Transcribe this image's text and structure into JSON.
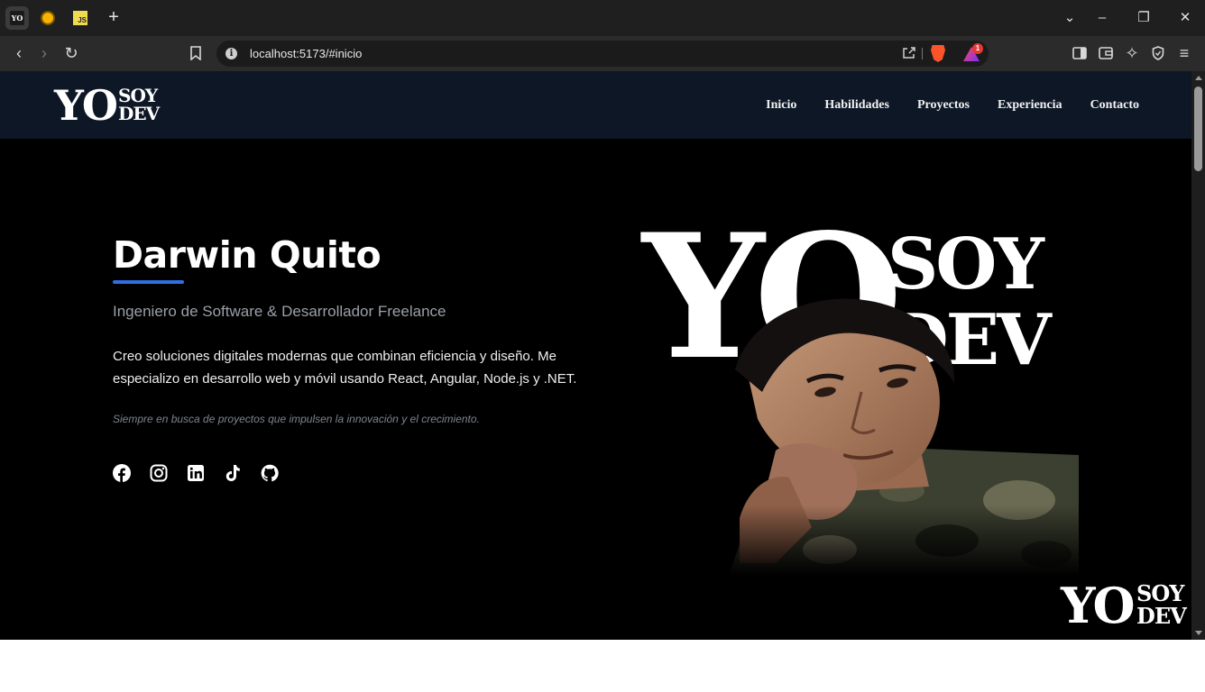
{
  "browser": {
    "url": "localhost:5173/#inicio",
    "tabs": [
      {
        "icon": "yosoydev-favicon"
      },
      {
        "icon": "bot-favicon"
      },
      {
        "icon": "js-favicon",
        "label": "JS"
      }
    ],
    "new_tab_label": "+",
    "notification_count": "1"
  },
  "site": {
    "logo": {
      "yo": "YO",
      "soy": "SOY",
      "dev": "DEV"
    },
    "nav": [
      "Inicio",
      "Habilidades",
      "Proyectos",
      "Experiencia",
      "Contacto"
    ],
    "hero": {
      "name": "Darwin Quito",
      "subtitle": "Ingeniero de Software & Desarrollador Freelance",
      "description": "Creo soluciones digitales modernas que combinan eficiencia y diseño. Me especializo en desarrollo web y móvil usando React, Angular, Node.js y .NET.",
      "quote": "Siempre en busca de proyectos que impulsen la innovación y el crecimiento."
    },
    "socials": [
      "facebook",
      "instagram",
      "linkedin",
      "tiktok",
      "github"
    ]
  },
  "colors": {
    "nav_bg": "#0e1726",
    "accent": "#2f6fe0",
    "page_bg": "#000000"
  }
}
